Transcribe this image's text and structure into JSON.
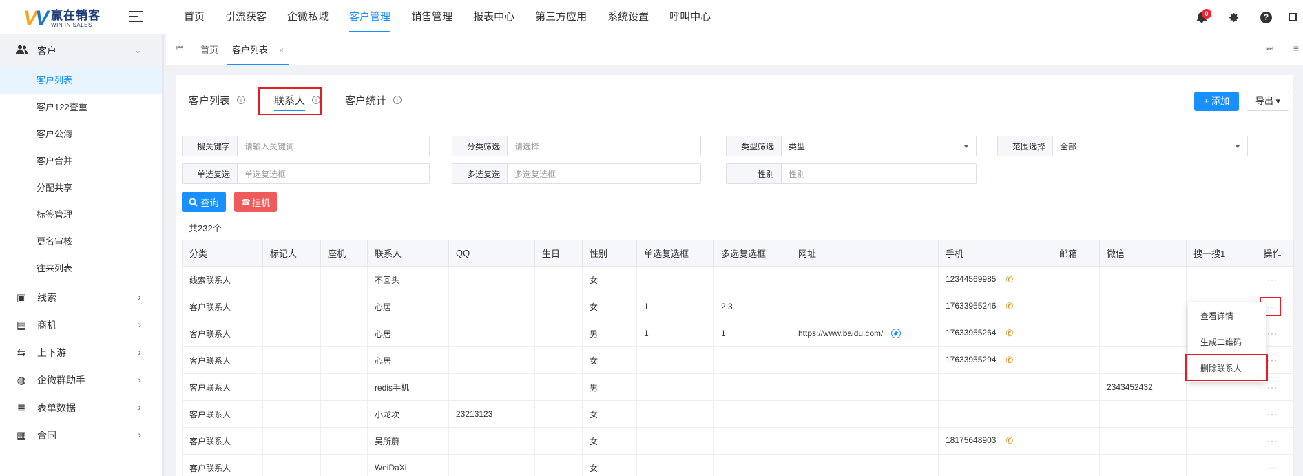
{
  "brand": {
    "mark_w": "W",
    "name_cn": "赢在销客",
    "name_en": "WIN IN SALES"
  },
  "topnav": [
    "首页",
    "引流获客",
    "企微私域",
    "客户管理",
    "销售管理",
    "报表中心",
    "第三方应用",
    "系统设置",
    "呼叫中心"
  ],
  "topnav_active": "客户管理",
  "notifications": {
    "count": "0"
  },
  "icons": {
    "theme": "moon-icon",
    "bell": "bell-icon",
    "settings": "gear-icon",
    "help": "help-icon"
  },
  "sidebar": {
    "open_group": "客户",
    "sub_items": [
      "客户列表",
      "客户122查重",
      "客户公海",
      "客户合并",
      "分配共享",
      "标签管理",
      "更名审核",
      "往来列表"
    ],
    "active_sub": "客户列表",
    "groups": [
      "线索",
      "商机",
      "上下游",
      "企微群助手",
      "表单数据",
      "合同"
    ]
  },
  "tabs": {
    "home": "首页",
    "current": "客户列表",
    "close": "×"
  },
  "subtabs": [
    "客户列表",
    "联系人",
    "客户统计"
  ],
  "subtab_active": "联系人",
  "actions": {
    "add": "+ 添加",
    "export": "导出 ▾"
  },
  "filters": {
    "keyword": {
      "label": "搜关键字",
      "placeholder": "请输入关键词"
    },
    "category": {
      "label": "分类筛选",
      "placeholder": "请选择"
    },
    "type": {
      "label": "类型筛选",
      "value": "类型"
    },
    "range": {
      "label": "范围选择",
      "value": "全部"
    },
    "single": {
      "label": "单选复选",
      "placeholder": "单选复选框"
    },
    "multi": {
      "label": "多选复选",
      "placeholder": "多选复选框"
    },
    "gender": {
      "label": "性别",
      "placeholder": "性别"
    }
  },
  "buttons": {
    "query": "查询",
    "hangup": "挂机"
  },
  "total": "共232个",
  "table": {
    "headers": [
      "分类",
      "标记人",
      "座机",
      "联系人",
      "QQ",
      "生日",
      "性别",
      "单选复选框",
      "多选复选框",
      "网址",
      "手机",
      "邮箱",
      "微信",
      "搜一搜1",
      "操作"
    ],
    "rows": [
      [
        "线索联系人",
        "",
        "",
        "不回头",
        "",
        "",
        "女",
        "",
        "",
        "",
        "12344569985",
        "",
        "",
        "",
        "···"
      ],
      [
        "客户联系人",
        "",
        "",
        "心居",
        "",
        "",
        "女",
        "1",
        "2,3",
        "",
        "17633955246",
        "",
        "",
        "",
        "···"
      ],
      [
        "客户联系人",
        "",
        "",
        "心居",
        "",
        "",
        "男",
        "1",
        "1",
        "https://www.baidu.com/",
        "17633955264",
        "",
        "",
        "",
        "···"
      ],
      [
        "客户联系人",
        "",
        "",
        "心居",
        "",
        "",
        "女",
        "",
        "",
        "",
        "17633955294",
        "",
        "",
        "",
        "···"
      ],
      [
        "客户联系人",
        "",
        "",
        "redis手机",
        "",
        "",
        "男",
        "",
        "",
        "",
        "",
        "",
        "2343452432",
        "",
        "···"
      ],
      [
        "客户联系人",
        "",
        "",
        "小龙坎",
        "23213123",
        "",
        "女",
        "",
        "",
        "",
        "",
        "",
        "",
        "",
        "···"
      ],
      [
        "客户联系人",
        "",
        "",
        "吴所蔚",
        "",
        "",
        "女",
        "",
        "",
        "",
        "18175648903",
        "",
        "",
        "",
        "···"
      ],
      [
        "客户联系人",
        "",
        "",
        "WeiDaXi",
        "",
        "",
        "女",
        "",
        "",
        "",
        "",
        "",
        "",
        "",
        "···"
      ]
    ]
  },
  "popover": [
    "查看详情",
    "生成二维码",
    "删除联系人"
  ],
  "colors": {
    "accent": "#1890ff",
    "danger": "#f15a5a",
    "highlight": "#e11d26"
  }
}
